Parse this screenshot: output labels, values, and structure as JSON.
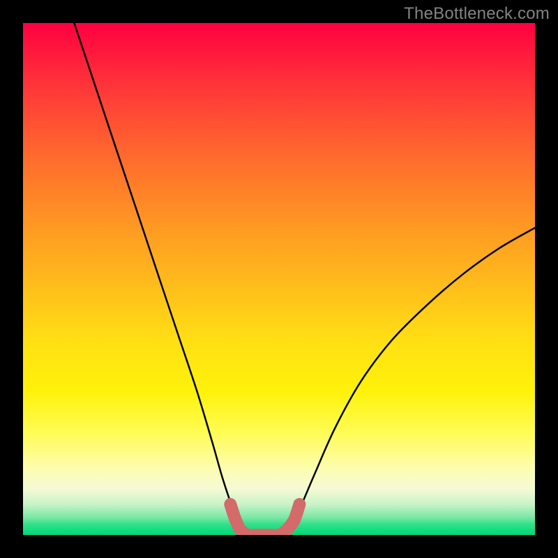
{
  "watermark": "TheBottleneck.com",
  "chart_data": {
    "type": "line",
    "title": "",
    "xlabel": "",
    "ylabel": "",
    "xlim": [
      0,
      100
    ],
    "ylim": [
      0,
      100
    ],
    "series": [
      {
        "name": "black-curve-left",
        "color": "#000000",
        "x": [
          10,
          14,
          18,
          22,
          26,
          30,
          34,
          37,
          39,
          41,
          42.5
        ],
        "values": [
          100,
          88,
          76,
          64,
          52,
          40,
          28,
          18,
          11,
          5,
          1
        ]
      },
      {
        "name": "black-curve-right",
        "color": "#000000",
        "x": [
          52,
          54,
          57,
          61,
          66,
          72,
          79,
          86,
          93,
          100
        ],
        "values": [
          1,
          5,
          12,
          21,
          30,
          38,
          45,
          51,
          56,
          60
        ]
      },
      {
        "name": "salmon-u",
        "color": "#d46a6a",
        "x": [
          40.5,
          41.5,
          42.5,
          44,
          46,
          48,
          50,
          51.5,
          53,
          54
        ],
        "values": [
          6,
          3,
          1,
          0,
          0,
          0,
          0,
          1,
          3,
          6
        ]
      }
    ],
    "gradient_stops": [
      {
        "pos": 0,
        "color": "#ff0040"
      },
      {
        "pos": 50,
        "color": "#ffb91c"
      },
      {
        "pos": 72,
        "color": "#fff20a"
      },
      {
        "pos": 100,
        "color": "#00d877"
      }
    ]
  }
}
